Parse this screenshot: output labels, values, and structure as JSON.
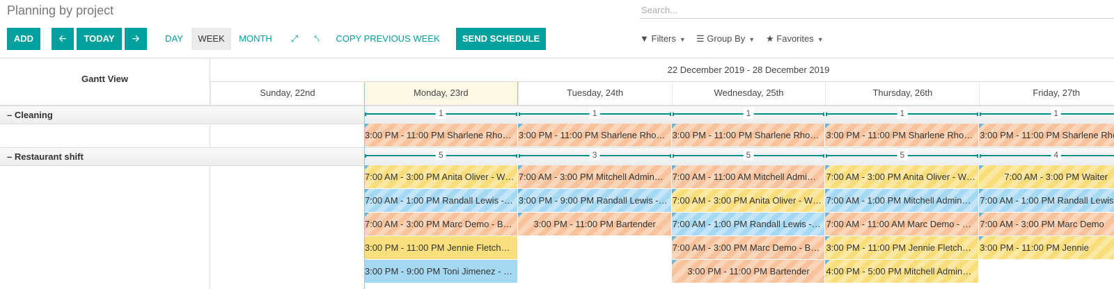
{
  "title": "Planning by project",
  "search_placeholder": "Search...",
  "toolbar": {
    "add": "ADD",
    "prev_icon": "arrow-left-icon",
    "today": "TODAY",
    "next_icon": "arrow-right-icon",
    "day": "DAY",
    "week": "WEEK",
    "month": "MONTH",
    "expand_icon": "expand-icon",
    "collapse_icon": "collapse-icon",
    "copy_prev": "COPY PREVIOUS WEEK",
    "send": "SEND SCHEDULE",
    "filters": "Filters",
    "group_by": "Group By",
    "favorites": "Favorites"
  },
  "gantt": {
    "view_label": "Gantt View",
    "range": "22 December 2019 - 28 December 2019",
    "days": [
      "Sunday, 22nd",
      "Monday, 23rd",
      "Tuesday, 24th",
      "Wednesday, 25th",
      "Thursday, 26th",
      "Friday, 27th"
    ],
    "groups": [
      {
        "name": "Cleaning",
        "counts": [
          "",
          "1",
          "1",
          "1",
          "1",
          "1"
        ],
        "rows": [
          [
            null,
            {
              "t": "3:00 PM - 11:00 PM Sharlene Rho…",
              "c": "orange"
            },
            {
              "t": "3:00 PM - 11:00 PM Sharlene Rho…",
              "c": "orange"
            },
            {
              "t": "3:00 PM - 11:00 PM Sharlene Rho…",
              "c": "orange"
            },
            {
              "t": "3:00 PM - 11:00 PM Sharlene Rho…",
              "c": "orange"
            },
            {
              "t": "3:00 PM - 11:00 PM Sharlene Rho…",
              "c": "orange"
            }
          ]
        ]
      },
      {
        "name": "Restaurant shift",
        "counts": [
          "",
          "5",
          "3",
          "5",
          "5",
          "4"
        ],
        "rows": [
          [
            null,
            {
              "t": "7:00 AM - 3:00 PM Anita Oliver - W…",
              "c": "yellow"
            },
            {
              "t": "7:00 AM - 3:00 PM Mitchell Admin…",
              "c": "orange"
            },
            {
              "t": "7:00 AM - 11:00 AM Mitchell Admi…",
              "c": "orange"
            },
            {
              "t": "7:00 AM - 3:00 PM Anita Oliver - W…",
              "c": "yellow"
            },
            {
              "t": "7:00 AM - 3:00 PM Waiter",
              "c": "yellow",
              "center": true
            }
          ],
          [
            null,
            {
              "t": "7:00 AM - 1:00 PM Randall Lewis -…",
              "c": "blue"
            },
            {
              "t": "3:00 PM - 9:00 PM Randall Lewis -…",
              "c": "blue"
            },
            {
              "t": "7:00 AM - 3:00 PM Anita Oliver - W…",
              "c": "yellow"
            },
            {
              "t": "7:00 AM - 1:00 PM Mitchell Admin…",
              "c": "blue"
            },
            {
              "t": "7:00 AM - 1:00 PM Randall Lewis",
              "c": "blue"
            }
          ],
          [
            null,
            {
              "t": "7:00 AM - 3:00 PM Marc Demo - B…",
              "c": "orange"
            },
            {
              "t": "3:00 PM - 11:00 PM Bartender",
              "c": "orange",
              "center": true
            },
            {
              "t": "7:00 AM - 1:00 PM Randall Lewis -…",
              "c": "blue"
            },
            {
              "t": "7:00 AM - 11:00 AM Marc Demo - …",
              "c": "orange"
            },
            {
              "t": "7:00 AM - 3:00 PM Marc Demo",
              "c": "orange"
            }
          ],
          [
            null,
            {
              "t": "3:00 PM - 11:00 PM Jennie Fletch…",
              "c": "yellow",
              "solid": true
            },
            null,
            {
              "t": "7:00 AM - 3:00 PM Marc Demo - B…",
              "c": "orange"
            },
            {
              "t": "3:00 PM - 11:00 PM Jennie Fletch…",
              "c": "yellow"
            },
            {
              "t": "3:00 PM - 11:00 PM Jennie",
              "c": "yellow"
            }
          ],
          [
            null,
            {
              "t": "3:00 PM - 9:00 PM Toni Jimenez - …",
              "c": "blue",
              "solid": true
            },
            null,
            {
              "t": "3:00 PM - 11:00 PM Bartender",
              "c": "orange",
              "center": true
            },
            {
              "t": "4:00 PM - 5:00 PM Mitchell Admin…",
              "c": "yellow"
            },
            null
          ]
        ]
      }
    ]
  }
}
